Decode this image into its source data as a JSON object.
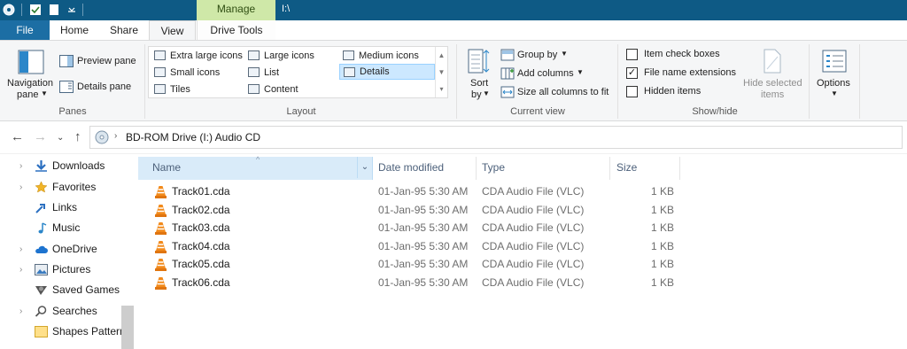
{
  "titlebar": {
    "manage_tab": "Manage",
    "path_text": "I:\\"
  },
  "tabs": {
    "file": "File",
    "home": "Home",
    "share": "Share",
    "view": "View",
    "drive_tools": "Drive Tools"
  },
  "ribbon": {
    "panes": {
      "navigation_pane_line1": "Navigation",
      "navigation_pane_line2": "pane",
      "preview_pane": "Preview pane",
      "details_pane": "Details pane",
      "group_label": "Panes"
    },
    "layout": {
      "items": {
        "extra_large": "Extra large icons",
        "large": "Large icons",
        "medium": "Medium icons",
        "small": "Small icons",
        "list": "List",
        "details": "Details",
        "tiles": "Tiles",
        "content": "Content"
      },
      "selected": "Details",
      "group_label": "Layout"
    },
    "current_view": {
      "sort_line1": "Sort",
      "sort_line2": "by",
      "group_by": "Group by",
      "add_columns": "Add columns",
      "size_all_columns": "Size all columns to fit",
      "group_label": "Current view"
    },
    "show_hide": {
      "item_check_boxes": "Item check boxes",
      "item_check_boxes_checked": false,
      "file_name_extensions": "File name extensions",
      "file_name_extensions_checked": true,
      "hidden_items": "Hidden items",
      "hidden_items_checked": false,
      "hide_selected_line1": "Hide selected",
      "hide_selected_line2": "items",
      "group_label": "Show/hide"
    },
    "options": {
      "label": "Options"
    }
  },
  "address": {
    "text": "BD-ROM Drive (I:) Audio CD"
  },
  "nav_items": [
    {
      "label": "Downloads",
      "icon": "download-arrow-icon",
      "expandable": true
    },
    {
      "label": "Favorites",
      "icon": "star-icon",
      "expandable": true
    },
    {
      "label": "Links",
      "icon": "links-icon",
      "expandable": false
    },
    {
      "label": "Music",
      "icon": "music-note-icon",
      "expandable": false
    },
    {
      "label": "OneDrive",
      "icon": "cloud-icon",
      "expandable": true
    },
    {
      "label": "Pictures",
      "icon": "pictures-icon",
      "expandable": true
    },
    {
      "label": "Saved Games",
      "icon": "saved-games-icon",
      "expandable": false
    },
    {
      "label": "Searches",
      "icon": "search-icon",
      "expandable": true
    },
    {
      "label": "Shapes Pattern",
      "icon": "folder-icon",
      "expandable": false
    }
  ],
  "columns": {
    "name": "Name",
    "date_modified": "Date modified",
    "type": "Type",
    "size": "Size"
  },
  "files": [
    {
      "name": "Track01.cda",
      "date": "01-Jan-95 5:30 AM",
      "type": "CDA Audio File (VLC)",
      "size": "1 KB"
    },
    {
      "name": "Track02.cda",
      "date": "01-Jan-95 5:30 AM",
      "type": "CDA Audio File (VLC)",
      "size": "1 KB"
    },
    {
      "name": "Track03.cda",
      "date": "01-Jan-95 5:30 AM",
      "type": "CDA Audio File (VLC)",
      "size": "1 KB"
    },
    {
      "name": "Track04.cda",
      "date": "01-Jan-95 5:30 AM",
      "type": "CDA Audio File (VLC)",
      "size": "1 KB"
    },
    {
      "name": "Track05.cda",
      "date": "01-Jan-95 5:30 AM",
      "type": "CDA Audio File (VLC)",
      "size": "1 KB"
    },
    {
      "name": "Track06.cda",
      "date": "01-Jan-95 5:30 AM",
      "type": "CDA Audio File (VLC)",
      "size": "1 KB"
    }
  ],
  "colors": {
    "titlebar": "#0e5a85",
    "file_tab": "#1c6ea4",
    "manage_tab": "#cfe8a8",
    "selection": "#cce8ff"
  }
}
